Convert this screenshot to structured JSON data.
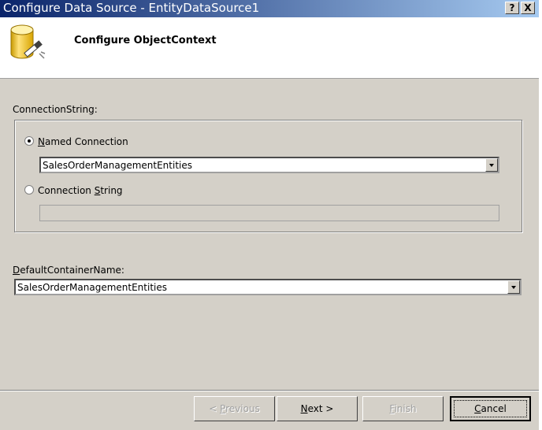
{
  "window": {
    "title": "Configure Data Source - EntityDataSource1",
    "help_glyph": "?",
    "close_glyph": "X"
  },
  "header": {
    "title": "Configure ObjectContext",
    "icon": "database-wand-icon"
  },
  "connection": {
    "section_label": "ConnectionString:",
    "named_option": {
      "pre": "",
      "mnemonic": "N",
      "post": "amed Connection",
      "checked": true
    },
    "named_value": "SalesOrderManagementEntities",
    "string_option": {
      "pre": "Connection ",
      "mnemonic": "S",
      "post": "tring",
      "checked": false
    },
    "string_value": ""
  },
  "container": {
    "label_mnemonic": "D",
    "label_rest": "efaultContainerName:",
    "value": "SalesOrderManagementEntities"
  },
  "buttons": {
    "previous": {
      "pre": "< ",
      "mnemonic": "P",
      "post": "revious",
      "enabled": false
    },
    "next": {
      "pre": "",
      "mnemonic": "N",
      "post": "ext >",
      "enabled": true
    },
    "finish": {
      "pre": "",
      "mnemonic": "F",
      "post": "inish",
      "enabled": false
    },
    "cancel": {
      "pre": "",
      "mnemonic": "C",
      "post": "ancel",
      "enabled": true
    }
  },
  "colors": {
    "title_gradient_start": "#0a246a",
    "title_gradient_end": "#a6caf0",
    "dialog_face": "#d4d0c8"
  }
}
